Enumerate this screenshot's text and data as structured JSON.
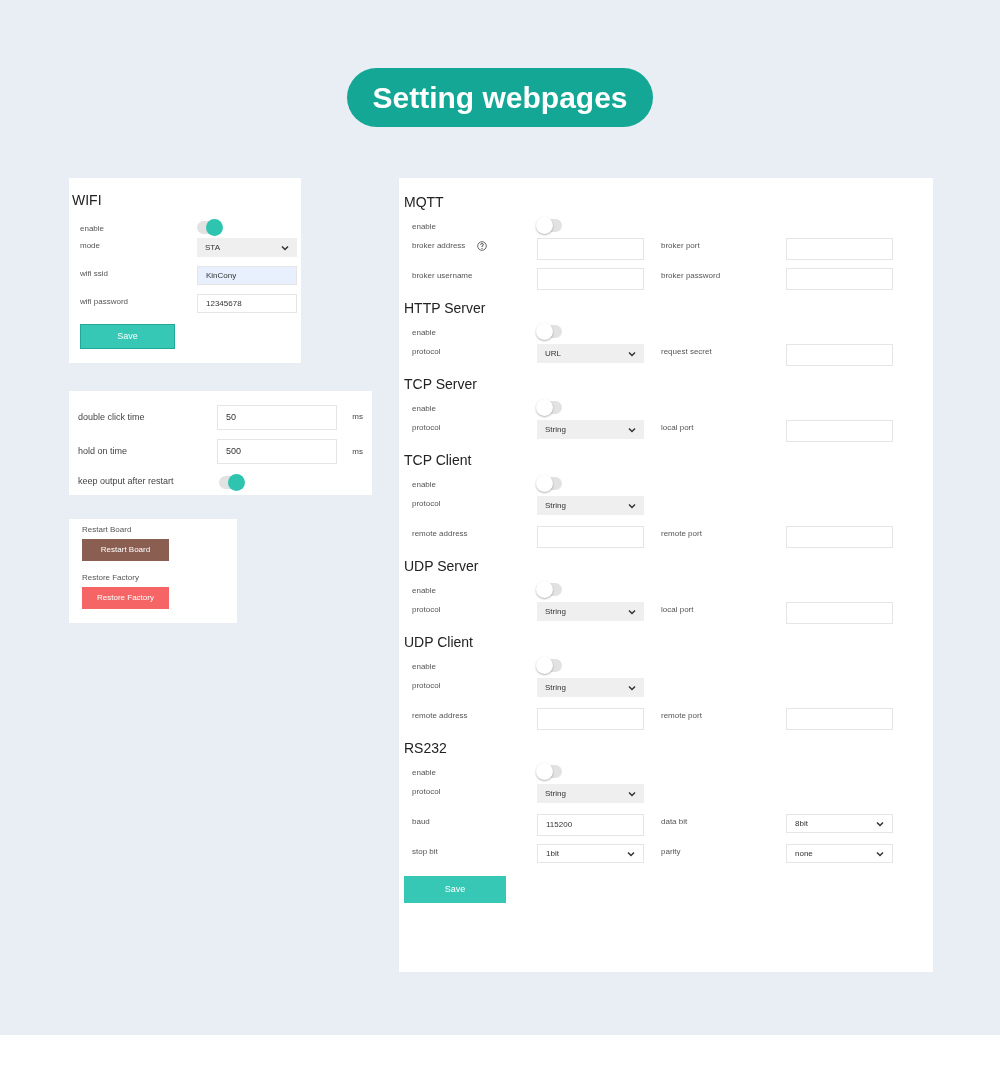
{
  "title": "Setting webpages",
  "wifi": {
    "heading": "WIFI",
    "rows": [
      {
        "label": "enable",
        "kind": "toggle",
        "on": true
      },
      {
        "label": "mode",
        "kind": "select",
        "value": "STA"
      },
      {
        "label": "wifi ssid",
        "kind": "input",
        "value": "KinCony",
        "autofilled": true
      },
      {
        "label": "wifi password",
        "kind": "input",
        "value": "12345678",
        "autofilled": false
      }
    ],
    "save": "Save"
  },
  "timing": {
    "rows": [
      {
        "label": "double click time",
        "kind": "input",
        "value": "50",
        "unit": "ms"
      },
      {
        "label": "hold on time",
        "kind": "input",
        "value": "500",
        "unit": "ms"
      },
      {
        "label": "keep output after restart",
        "kind": "toggle",
        "on": true
      }
    ]
  },
  "maintenance": [
    {
      "label": "Restart Board",
      "button": "Restart Board",
      "color": "#8b5e52"
    },
    {
      "label": "Restore Factory",
      "button": "Restore Factory",
      "color": "#f56565"
    }
  ],
  "services": {
    "sections": [
      {
        "heading": "MQTT",
        "rows": [
          {
            "fields": [
              {
                "label": "enable",
                "kind": "toggle",
                "on": false
              }
            ]
          },
          {
            "fields": [
              {
                "label": "broker address",
                "kind": "input",
                "help": true
              },
              {
                "label": "broker port",
                "kind": "input"
              }
            ]
          },
          {
            "fields": [
              {
                "label": "broker username",
                "kind": "input"
              },
              {
                "label": "broker password",
                "kind": "input"
              }
            ]
          }
        ]
      },
      {
        "heading": "HTTP Server",
        "rows": [
          {
            "fields": [
              {
                "label": "enable",
                "kind": "toggle",
                "on": false
              }
            ]
          },
          {
            "fields": [
              {
                "label": "protocol",
                "kind": "select",
                "value": "URL"
              },
              {
                "label": "request secret",
                "kind": "input"
              }
            ]
          }
        ]
      },
      {
        "heading": "TCP Server",
        "rows": [
          {
            "fields": [
              {
                "label": "enable",
                "kind": "toggle",
                "on": false
              }
            ]
          },
          {
            "fields": [
              {
                "label": "protocol",
                "kind": "select",
                "value": "String"
              },
              {
                "label": "local port",
                "kind": "input"
              }
            ]
          }
        ]
      },
      {
        "heading": "TCP Client",
        "rows": [
          {
            "fields": [
              {
                "label": "enable",
                "kind": "toggle",
                "on": false
              }
            ]
          },
          {
            "fields": [
              {
                "label": "protocol",
                "kind": "select",
                "value": "String"
              }
            ]
          },
          {
            "fields": [
              {
                "label": "remote address",
                "kind": "input"
              },
              {
                "label": "remote port",
                "kind": "input"
              }
            ]
          }
        ]
      },
      {
        "heading": "UDP Server",
        "rows": [
          {
            "fields": [
              {
                "label": "enable",
                "kind": "toggle",
                "on": false
              }
            ]
          },
          {
            "fields": [
              {
                "label": "protocol",
                "kind": "select",
                "value": "String"
              },
              {
                "label": "local port",
                "kind": "input"
              }
            ]
          }
        ]
      },
      {
        "heading": "UDP Client",
        "rows": [
          {
            "fields": [
              {
                "label": "enable",
                "kind": "toggle",
                "on": false
              }
            ]
          },
          {
            "fields": [
              {
                "label": "protocol",
                "kind": "select",
                "value": "String"
              }
            ]
          },
          {
            "fields": [
              {
                "label": "remote address",
                "kind": "input"
              },
              {
                "label": "remote port",
                "kind": "input"
              }
            ]
          }
        ]
      },
      {
        "heading": "RS232",
        "rows": [
          {
            "fields": [
              {
                "label": "enable",
                "kind": "toggle",
                "on": false
              }
            ]
          },
          {
            "fields": [
              {
                "label": "protocol",
                "kind": "select",
                "value": "String"
              }
            ]
          },
          {
            "fields": [
              {
                "label": "baud",
                "kind": "input",
                "value": "115200"
              },
              {
                "label": "data bit",
                "kind": "choice",
                "value": "8bit"
              }
            ]
          },
          {
            "fields": [
              {
                "label": "stop bit",
                "kind": "choice",
                "value": "1bit"
              },
              {
                "label": "parity",
                "kind": "choice",
                "value": "none"
              }
            ]
          }
        ]
      }
    ],
    "save": "Save"
  }
}
